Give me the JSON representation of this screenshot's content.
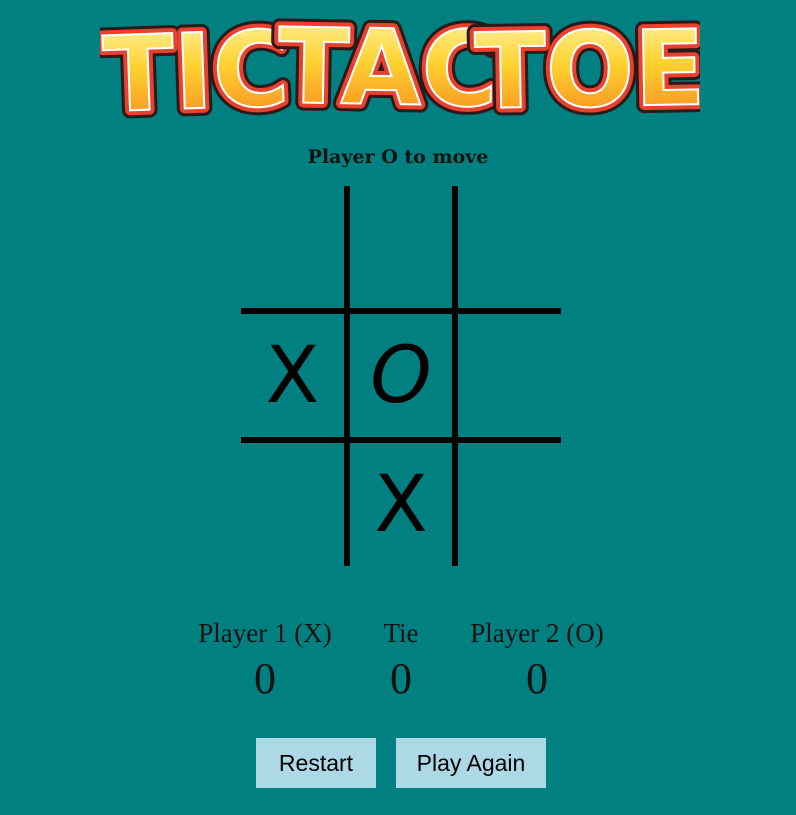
{
  "logo": {
    "text": "TIC TAC TOE",
    "words": [
      "TIC",
      "TAC",
      "TOE"
    ]
  },
  "status": "Player O to move",
  "board": {
    "cells": [
      "",
      "",
      "",
      "X",
      "O",
      "",
      "",
      "X",
      ""
    ]
  },
  "scores": [
    {
      "label": "Player 1 (X)",
      "value": "0"
    },
    {
      "label": "Tie",
      "value": "0"
    },
    {
      "label": "Player 2 (O)",
      "value": "0"
    }
  ],
  "buttons": {
    "restart": "Restart",
    "play_again": "Play Again"
  },
  "colors": {
    "background": "#008080",
    "button": "#add8e6",
    "logo_fill_top": "#fff59d",
    "logo_fill_bottom": "#f7931e",
    "logo_outline": "#e8412e"
  }
}
